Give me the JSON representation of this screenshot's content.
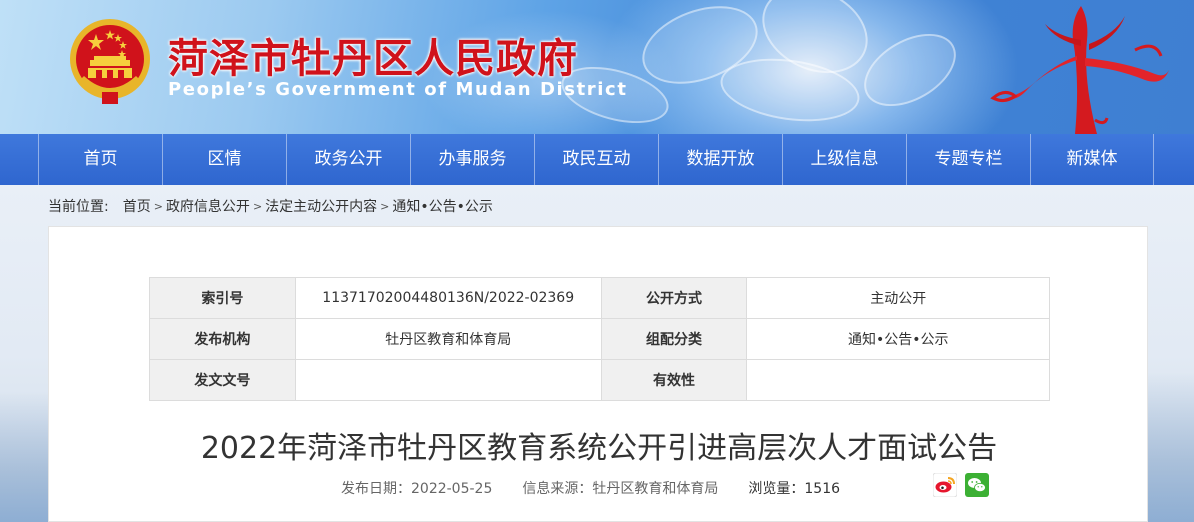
{
  "header": {
    "title": "菏泽市牡丹区人民政府",
    "subtitle": "People’s Government of Mudan District"
  },
  "nav": {
    "items": [
      "首页",
      "区情",
      "政务公开",
      "办事服务",
      "政民互动",
      "数据开放",
      "上级信息",
      "专题专栏",
      "新媒体"
    ]
  },
  "breadcrumb": {
    "label": "当前位置:",
    "items": [
      "首页",
      "政府信息公开",
      "法定主动公开内容",
      "通知•公告•公示"
    ]
  },
  "meta_table": {
    "rows": [
      [
        {
          "k": "索引号",
          "v": "11371702004480136N/2022-02369"
        },
        {
          "k": "公开方式",
          "v": "主动公开"
        }
      ],
      [
        {
          "k": "发布机构",
          "v": "牡丹区教育和体育局"
        },
        {
          "k": "组配分类",
          "v": "通知•公告•公示"
        }
      ],
      [
        {
          "k": "发文文号",
          "v": ""
        },
        {
          "k": "有效性",
          "v": ""
        }
      ]
    ]
  },
  "article": {
    "title": "2022年菏泽市牡丹区教育系统公开引进高层次人才面试公告",
    "date_label": "发布日期：2022-05-25",
    "source_label": "信息来源：牡丹区教育和体育局",
    "views_label": "浏览量：",
    "views": "1516"
  },
  "share": {
    "icons": [
      "weibo-icon",
      "wechat-icon"
    ]
  },
  "colors": {
    "title_red": "#d0121b",
    "nav_blue": "#3370d6"
  }
}
